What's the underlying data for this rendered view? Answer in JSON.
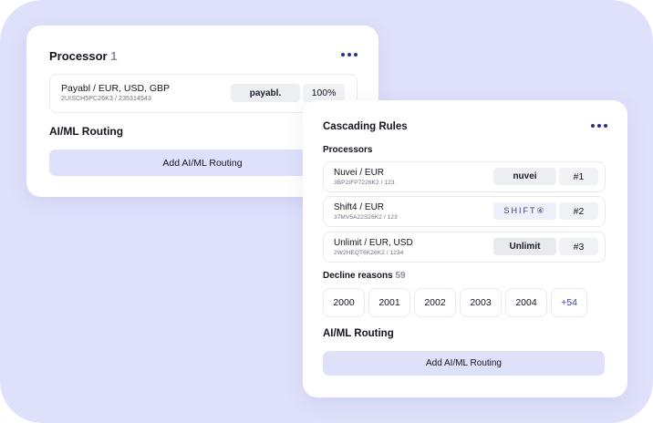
{
  "processor_card": {
    "title": "Processor",
    "count": "1",
    "row": {
      "name": "Payabl / EUR, USD, GBP",
      "id": "2UISCH5PC26K3 / 235314543",
      "logo": "payabl.",
      "percent": "100%"
    },
    "routing_title": "AI/ML Routing",
    "add_button": "Add AI/ML Routing"
  },
  "cascading_card": {
    "title": "Cascading Rules",
    "processors_label": "Processors",
    "processors": [
      {
        "name": "Nuvei / EUR",
        "id": "3BP2IFP7226K2 / 123",
        "logo": "nuvei",
        "rank": "#1"
      },
      {
        "name": "Shift4 / EUR",
        "id": "37MV5A22S26K2 / 123",
        "logo": "SHIFT④",
        "rank": "#2"
      },
      {
        "name": "Unlimit / EUR, USD",
        "id": "2W2HEQT6K26K2 / 1234",
        "logo": "Unlimit",
        "rank": "#3"
      }
    ],
    "decline_label": "Decline reasons",
    "decline_count": "59",
    "decline_codes": [
      "2000",
      "2001",
      "2002",
      "2003",
      "2004",
      "+54"
    ],
    "routing_title": "AI/ML Routing",
    "add_button": "Add AI/ML Routing"
  },
  "colors": {
    "background": "#dfe1fb",
    "accent": "#2d2f8c",
    "button": "#dfe1fb"
  },
  "icons": {
    "menu": "more-dots-icon"
  }
}
